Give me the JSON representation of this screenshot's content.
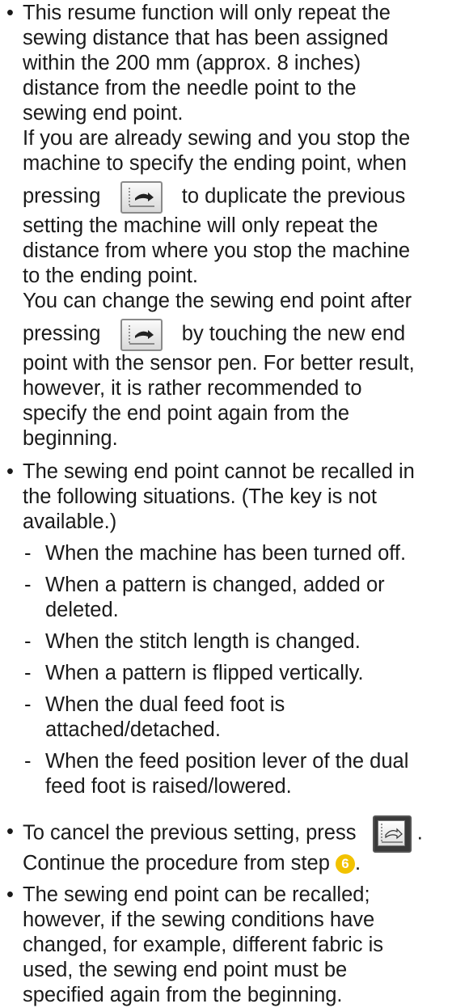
{
  "bullet_symbol": "•",
  "items": [
    {
      "lines": [
        "This resume function will only repeat the",
        "sewing distance that has been assigned",
        "within the 200 mm (approx. 8 inches)",
        "distance from the needle point to the",
        "sewing end point.",
        "If you are already sewing and you stop the",
        "machine to specify the ending point, when"
      ],
      "press_text": "pressing",
      "after_key_1": "to duplicate the previous",
      "lines_2": [
        "setting the machine will only repeat the",
        "distance from where you stop the machine",
        "to the ending point.",
        "You can change the sewing end point after"
      ],
      "after_key_2": "by touching the new end",
      "lines_3": [
        "point with the sensor pen. For better result,",
        "however, it is rather recommended to",
        "specify the end point again from the",
        "beginning."
      ]
    },
    {
      "lines": [
        "The sewing end point cannot be recalled in",
        "the following situations. (The key is not",
        "available.)"
      ],
      "subitems": [
        [
          "When the machine has been turned off."
        ],
        [
          "When a pattern is changed, added or",
          "deleted."
        ],
        [
          "When the stitch length is changed."
        ],
        [
          "When a pattern is flipped vertically."
        ],
        [
          "When the dual feed foot is",
          "attached/detached."
        ],
        [
          "When the feed position lever of the dual",
          "feed foot is raised/lowered."
        ]
      ]
    },
    {
      "line_before_key": "To cancel the previous setting, press",
      "after_key": ".",
      "continue_text": "Continue the procedure from step",
      "step_number": "6",
      "continue_end": "."
    },
    {
      "lines": [
        "The sewing end point can be recalled;",
        "however, if the sewing conditions have",
        "changed, for example, different fabric is",
        "used, the sewing end point must be",
        "specified again from the beginning."
      ]
    }
  ],
  "icons": {
    "resume_key": "sewing-end-point-resume-icon",
    "cancel_key": "sewing-end-point-cancel-icon"
  }
}
